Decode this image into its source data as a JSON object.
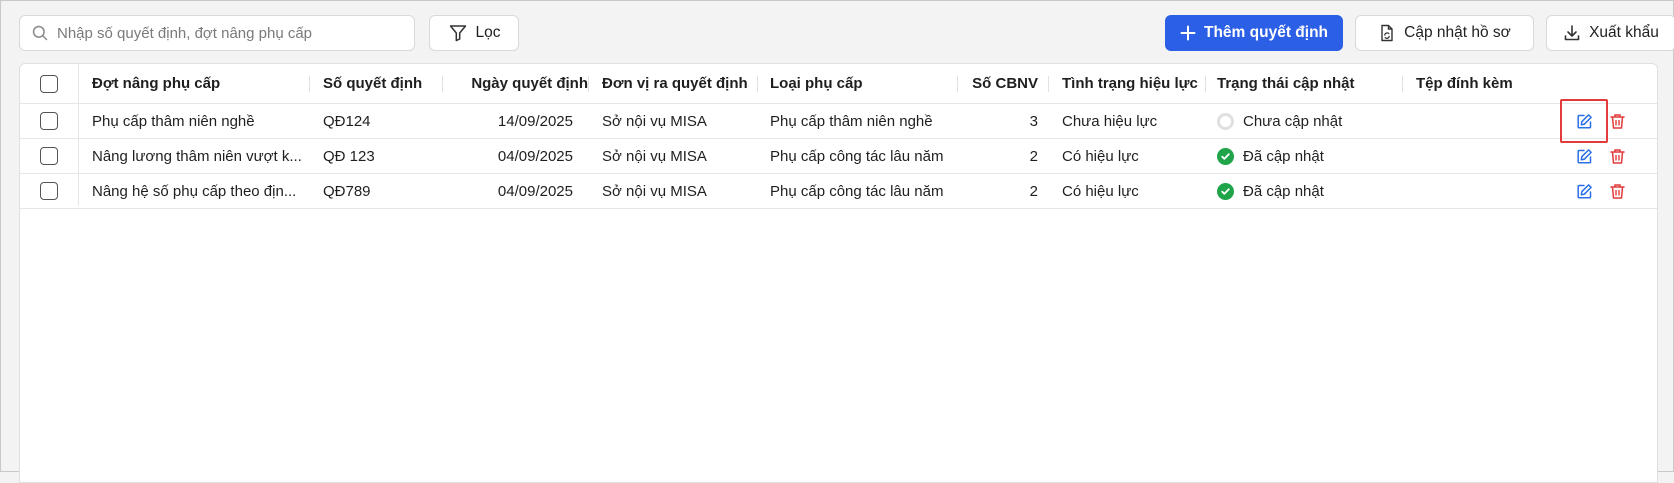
{
  "toolbar": {
    "search_placeholder": "Nhập số quyết định, đợt nâng phụ cấp",
    "search_value": "",
    "filter_label": "Lọc",
    "add_label": "Thêm quyết định",
    "update_label": "Cập nhật hồ sơ",
    "export_label": "Xuất khẩu"
  },
  "colors": {
    "primary": "#2b5fe6",
    "success": "#1fa44a",
    "danger": "#e23b3b",
    "edit": "#2b6fe6"
  },
  "table": {
    "columns": [
      "Đợt nâng phụ cấp",
      "Số quyết định",
      "Ngày quyết định",
      "Đơn vị ra quyết định",
      "Loại phụ cấp",
      "Số CBNV",
      "Tình trạng hiệu lực",
      "Trạng thái cập nhật",
      "Tệp đính kèm"
    ],
    "rows": [
      {
        "name": "Phụ cấp thâm niên nghề",
        "decision_no": "QĐ124",
        "date": "14/09/2025",
        "issuer": "Sở nội vụ MISA",
        "type": "Phụ cấp thâm niên nghề",
        "count": "3",
        "validity": "Chưa hiệu lực",
        "update_status": "Chưa cập nhật",
        "status_icon": "empty-circle-icon"
      },
      {
        "name": "Nâng lương thâm niên vượt k...",
        "decision_no": "QĐ 123",
        "date": "04/09/2025",
        "issuer": "Sở nội vụ MISA",
        "type": "Phụ cấp công tác lâu năm",
        "count": "2",
        "validity": "Có hiệu lực",
        "update_status": "Đã cập nhật",
        "status_icon": "check-circle-icon"
      },
      {
        "name": "Nâng hệ số phụ cấp theo địn...",
        "decision_no": "QĐ789",
        "date": "04/09/2025",
        "issuer": "Sở nội vụ MISA",
        "type": "Phụ cấp công tác lâu năm",
        "count": "2",
        "validity": "Có hiệu lực",
        "update_status": "Đã cập nhật",
        "status_icon": "check-circle-icon"
      }
    ]
  }
}
